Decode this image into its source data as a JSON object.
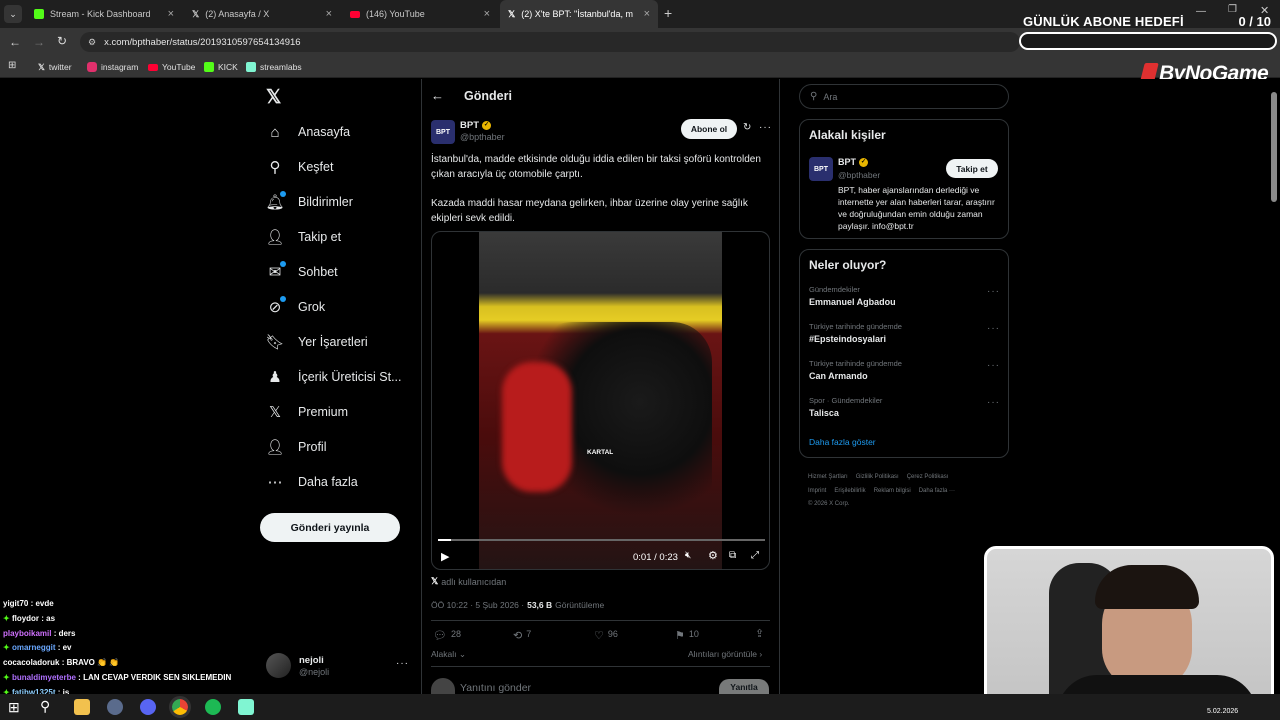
{
  "browser": {
    "tabs": [
      {
        "label": "Stream - Kick Dashboard",
        "color": "#53fc18"
      },
      {
        "label": "(2) Anasayfa / X",
        "color": "#ffffff"
      },
      {
        "label": "(146) YouTube",
        "color": "#ff0033"
      },
      {
        "label": "(2) X'te BPT: \"İstanbul'da, madd",
        "color": "#ffffff"
      }
    ],
    "url": "x.com/bpthaber/status/2019310597654134916",
    "bookmarks": [
      {
        "label": "twitter"
      },
      {
        "label": "instagram"
      },
      {
        "label": "YouTube"
      },
      {
        "label": "KICK"
      },
      {
        "label": "streamlabs"
      }
    ]
  },
  "overlay": {
    "goal_label": "GÜNLÜK ABONE HEDEFİ",
    "goal_count": "0 / 10",
    "brand": "ByNoGame"
  },
  "sidebar": {
    "items": [
      {
        "label": "Anasayfa",
        "icon": "home-icon",
        "glyph": "⌂"
      },
      {
        "label": "Keşfet",
        "icon": "search-icon",
        "glyph": "⚲"
      },
      {
        "label": "Bildirimler",
        "icon": "bell-icon",
        "glyph": "🔔︎"
      },
      {
        "label": "Takip et",
        "icon": "follow-icon",
        "glyph": "👤︎"
      },
      {
        "label": "Sohbet",
        "icon": "mail-icon",
        "glyph": "✉"
      },
      {
        "label": "Grok",
        "icon": "grok-icon",
        "glyph": "⊘"
      },
      {
        "label": "Yer İşaretleri",
        "icon": "bookmark-icon",
        "glyph": "🔖︎"
      },
      {
        "label": "İçerik Üreticisi St...",
        "icon": "creator-icon",
        "glyph": "♟"
      },
      {
        "label": "Premium",
        "icon": "x-premium-icon",
        "glyph": "𝕏"
      },
      {
        "label": "Profil",
        "icon": "profile-icon",
        "glyph": "👤︎"
      },
      {
        "label": "Daha fazla",
        "icon": "more-icon",
        "glyph": "⋯"
      }
    ],
    "post_button": "Gönderi yayınla",
    "account": {
      "name": "nejoli",
      "handle": "@nejoli"
    }
  },
  "post": {
    "header": "Gönderi",
    "author_name": "BPT",
    "author_handle": "@bpthaber",
    "avatar_text": "BPT",
    "subscribe": "Abone ol",
    "text1": "İstanbul'da, madde etkisinde olduğu iddia edilen bir taksi şoförü kontrolden çıkan aracıyla üç otomobile çarptı.",
    "text2": "Kazada maddi hasar meydana gelirken, ihbar üzerine olay yerine sağlık ekipleri sevk edildi.",
    "video_time": "0:01 / 0:23",
    "video_progress": 0.04,
    "video_watermark": "KARTAL",
    "source": "adlı kullanıcıdan",
    "time": "ÖÖ 10:22 · 5 Şub 2026 ·",
    "views_count": "53,6 B",
    "views_label": "Görüntüleme",
    "replies": "28",
    "reposts": "7",
    "likes": "96",
    "bookmarks": "10",
    "related": "Alakalı",
    "quotes": "Alıntıları görüntüle",
    "reply_placeholder": "Yanıtını gönder",
    "reply_button": "Yanıtla"
  },
  "right": {
    "search_placeholder": "Ara",
    "related_title": "Alakalı kişiler",
    "related_name": "BPT",
    "related_handle": "@bpthaber",
    "related_follow": "Takip et",
    "related_bio": "BPT, haber ajanslarından derlediği ve internette yer alan haberleri tarar, araştırır ve doğruluğundan emin olduğu zaman paylaşır. info@bpt.tr",
    "trends_title": "Neler oluyor?",
    "trends": [
      {
        "category": "Gündemdekiler",
        "name": "Emmanuel Agbadou"
      },
      {
        "category": "Türkiye tarihinde gündemde",
        "name": "#Epsteindosyalari"
      },
      {
        "category": "Türkiye tarihinde gündemde",
        "name": "Can Armando"
      },
      {
        "category": "Spor · Gündemdekiler",
        "name": "Talisca"
      }
    ],
    "show_more": "Daha fazla göster",
    "footer": [
      "Hizmet Şartları",
      "Gizlilik Politikası",
      "Çerez Politikası",
      "Imprint",
      "Erişilebilirlik",
      "Reklam bilgisi",
      "Daha fazla ···",
      "© 2026 X Corp."
    ]
  },
  "chat": [
    {
      "user": "yigit70",
      "msg": "evde",
      "color": "#ffffff",
      "badge": false
    },
    {
      "user": "floydor",
      "msg": "as",
      "color": "#ffffff",
      "badge": true
    },
    {
      "user": "playboikamil",
      "msg": "ders",
      "color": "#d070ff",
      "badge": false
    },
    {
      "user": "omarneggit",
      "msg": "ev",
      "color": "#6aa8ff",
      "badge": true
    },
    {
      "user": "cocacoladoruk",
      "msg": "BRAVO 👏 👏",
      "color": "#ffffff",
      "badge": false
    },
    {
      "user": "bunaldimyeterbe",
      "msg": "LAN CEVAP VERDIK SEN SIKLEMEDIN",
      "color": "#b070ff",
      "badge": true
    },
    {
      "user": "fatihw1325t",
      "msg": "iş",
      "color": "#8fd0ff",
      "badge": true
    }
  ],
  "taskbar": {
    "date": "5.02.2026"
  }
}
